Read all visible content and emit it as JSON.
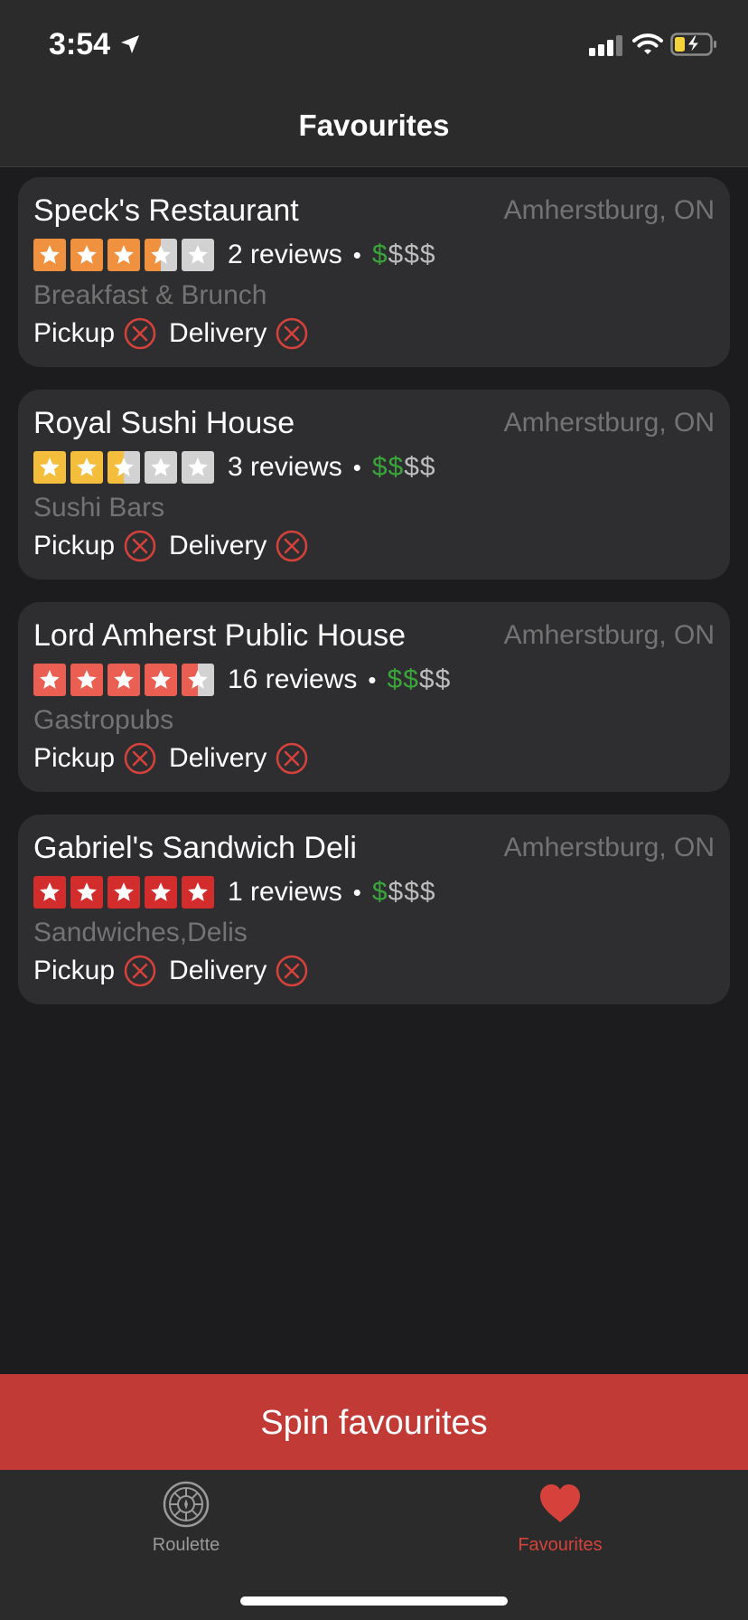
{
  "status": {
    "time": "3:54"
  },
  "nav": {
    "title": "Favourites"
  },
  "colors": {
    "accent": "#c23a36",
    "star_orange": "#f0913f",
    "star_yellow": "#f5bd3c",
    "star_salmon": "#ea5f51",
    "star_red": "#d22c2c",
    "star_empty": "#d2d2d2",
    "price_on": "#3aa53a"
  },
  "restaurants": [
    {
      "name": "Speck's Restaurant",
      "location": "Amherstburg, ON",
      "rating": 3.5,
      "star_color": "orange",
      "reviews": "2 reviews",
      "price_level": 1,
      "price_on": "$",
      "price_off": "$$$",
      "category": "Breakfast & Brunch",
      "pickup_label": "Pickup",
      "delivery_label": "Delivery"
    },
    {
      "name": "Royal Sushi House",
      "location": "Amherstburg, ON",
      "rating": 2.5,
      "star_color": "yellow",
      "reviews": "3 reviews",
      "price_level": 2,
      "price_on": "$$",
      "price_off": "$$",
      "category": "Sushi Bars",
      "pickup_label": "Pickup",
      "delivery_label": "Delivery"
    },
    {
      "name": "Lord Amherst Public House",
      "location": "Amherstburg, ON",
      "rating": 4.5,
      "star_color": "salmon",
      "reviews": "16 reviews",
      "price_level": 2,
      "price_on": "$$",
      "price_off": "$$",
      "category": "Gastropubs",
      "pickup_label": "Pickup",
      "delivery_label": "Delivery"
    },
    {
      "name": "Gabriel's Sandwich Deli",
      "location": "Amherstburg, ON",
      "rating": 5,
      "star_color": "red",
      "reviews": "1 reviews",
      "price_level": 1,
      "price_on": "$",
      "price_off": "$$$",
      "category": "Sandwiches,Delis",
      "pickup_label": "Pickup",
      "delivery_label": "Delivery"
    }
  ],
  "actions": {
    "spin_label": "Spin favourites"
  },
  "tabs": [
    {
      "label": "Roulette",
      "icon": "roulette-wheel-icon",
      "active": false
    },
    {
      "label": "Favourites",
      "icon": "heart-icon",
      "active": true
    }
  ]
}
